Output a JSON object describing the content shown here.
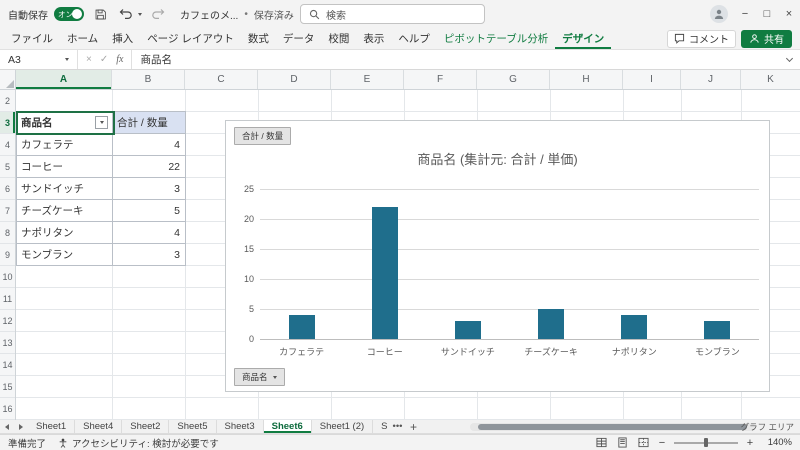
{
  "titlebar": {
    "autosave_label": "自動保存",
    "autosave_state": "オン",
    "filename": "カフェのメ...",
    "separator": "•",
    "save_status": "保存済み",
    "search_placeholder": "検索"
  },
  "ribbon": {
    "tabs": [
      {
        "label": "ファイル",
        "class": ""
      },
      {
        "label": "ホーム",
        "class": ""
      },
      {
        "label": "挿入",
        "class": ""
      },
      {
        "label": "ページ レイアウト",
        "class": ""
      },
      {
        "label": "数式",
        "class": ""
      },
      {
        "label": "データ",
        "class": ""
      },
      {
        "label": "校閲",
        "class": ""
      },
      {
        "label": "表示",
        "class": ""
      },
      {
        "label": "ヘルプ",
        "class": ""
      },
      {
        "label": "ピボットテーブル分析",
        "class": "contextual"
      },
      {
        "label": "デザイン",
        "class": "contextual active"
      }
    ],
    "comment_label": "コメント",
    "share_label": "共有"
  },
  "formula_bar": {
    "name_box": "A3",
    "cancel_glyph": "×",
    "enter_glyph": "✓",
    "fx_label": "fx",
    "value": "商品名"
  },
  "grid": {
    "column_headers": [
      "A",
      "B",
      "C",
      "D",
      "E",
      "F",
      "G",
      "H",
      "I",
      "J",
      "K"
    ],
    "row_headers": [
      2,
      3,
      4,
      5,
      6,
      7,
      8,
      9,
      10,
      11,
      12,
      13,
      14,
      15,
      16
    ]
  },
  "pivot_table": {
    "row_field_header": "商品名",
    "value_header": "合計 / 数量",
    "rows": [
      {
        "label": "カフェラテ",
        "value": 4
      },
      {
        "label": "コーヒー",
        "value": 22
      },
      {
        "label": "サンドイッチ",
        "value": 3
      },
      {
        "label": "チーズケーキ",
        "value": 5
      },
      {
        "label": "ナポリタン",
        "value": 4
      },
      {
        "label": "モンブラン",
        "value": 3
      }
    ]
  },
  "chart_data": {
    "type": "bar",
    "title": "商品名 (集計元: 合計 / 単価)",
    "categories": [
      "カフェラテ",
      "コーヒー",
      "サンドイッチ",
      "チーズケーキ",
      "ナポリタン",
      "モンブラン"
    ],
    "values": [
      4,
      22,
      3,
      5,
      4,
      3
    ],
    "ylim": [
      0,
      25
    ],
    "yticks": [
      0,
      5,
      10,
      15,
      20,
      25
    ],
    "bar_color": "#1f6e8c",
    "grid": true,
    "legend": "none",
    "field_buttons": {
      "value": "合計 / 数量",
      "axis": "商品名"
    }
  },
  "sheet_bar": {
    "tabs": [
      {
        "label": "Sheet1",
        "class": ""
      },
      {
        "label": "Sheet4",
        "class": ""
      },
      {
        "label": "Sheet2",
        "class": ""
      },
      {
        "label": "Sheet5",
        "class": ""
      },
      {
        "label": "Sheet3",
        "class": ""
      },
      {
        "label": "Sheet6",
        "class": "active"
      },
      {
        "label": "Sheet1 (2)",
        "class": ""
      },
      {
        "label": "S",
        "class": "clipped"
      }
    ],
    "more_label": "•••",
    "add_label": "+",
    "selection_name": "グラフ エリア"
  },
  "status_bar": {
    "mode": "準備完了",
    "accessibility": "アクセシビリティ: 検討が必要です",
    "zoom_out": "−",
    "zoom_in": "+",
    "zoom": "140%"
  }
}
